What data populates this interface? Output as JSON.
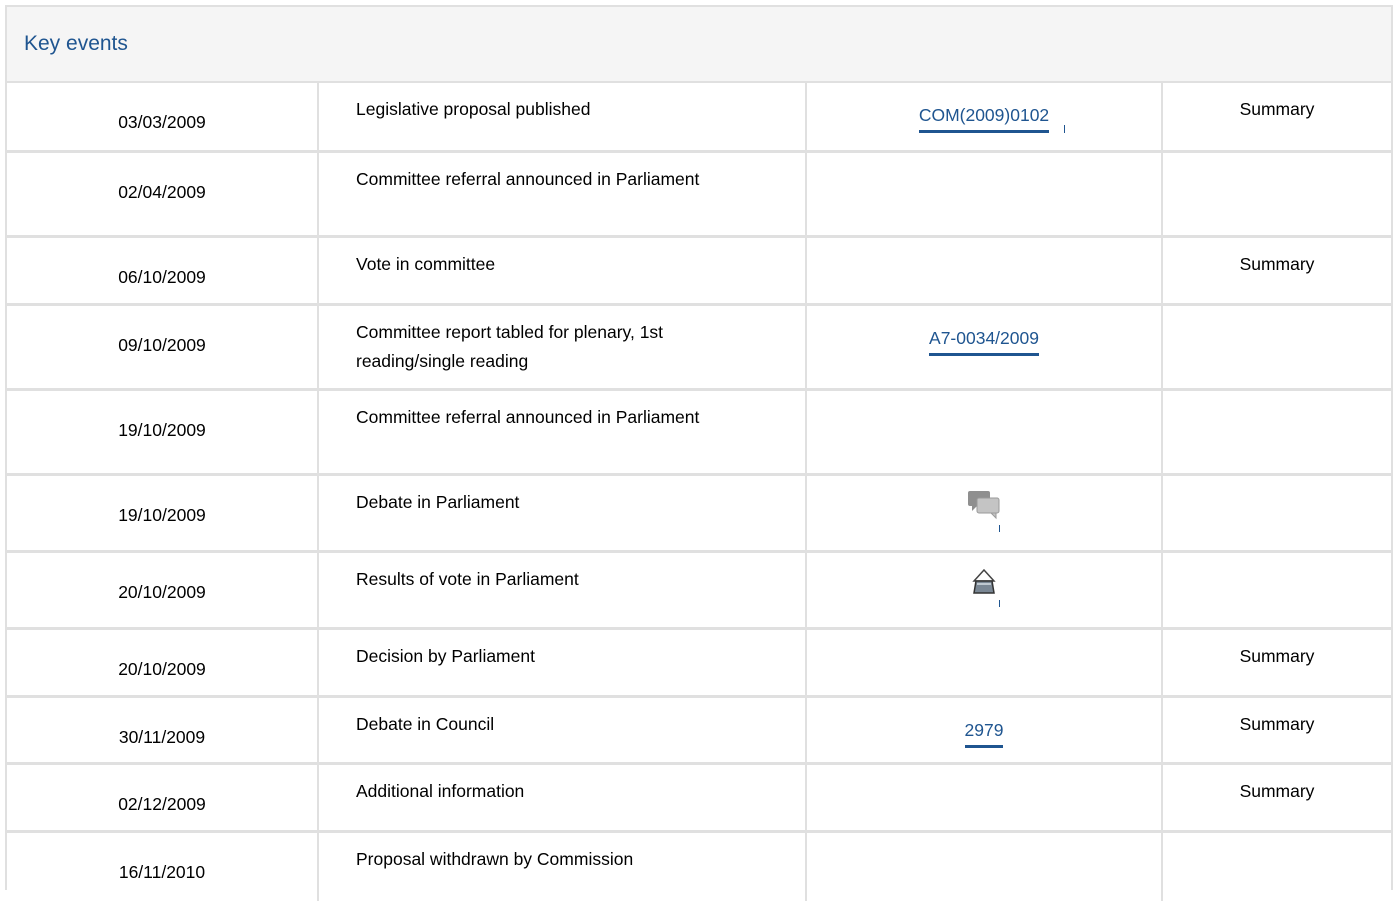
{
  "panel": {
    "title": "Key events"
  },
  "rows": [
    {
      "date": "03/03/2009",
      "event": "Legislative proposal published",
      "ref": "COM(2009)0102",
      "summary": "Summary"
    },
    {
      "date": "02/04/2009",
      "event": "Committee referral announced in Parliament",
      "ref": "",
      "summary": ""
    },
    {
      "date": "06/10/2009",
      "event": "Vote in committee",
      "ref": "",
      "summary": "Summary"
    },
    {
      "date": "09/10/2009",
      "event": "Committee report tabled for plenary, 1st reading/single reading",
      "ref": "A7-0034/2009",
      "summary": ""
    },
    {
      "date": "19/10/2009",
      "event": "Committee referral announced in Parliament",
      "ref": "",
      "summary": ""
    },
    {
      "date": "19/10/2009",
      "event": "Debate in Parliament",
      "ref_icon": "debate-icon",
      "summary": ""
    },
    {
      "date": "20/10/2009",
      "event": "Results of vote in Parliament",
      "ref_icon": "ballot-box-icon",
      "summary": ""
    },
    {
      "date": "20/10/2009",
      "event": "Decision by Parliament",
      "ref": "",
      "summary": "Summary"
    },
    {
      "date": "30/11/2009",
      "event": "Debate in Council",
      "ref": "2979",
      "summary": "Summary"
    },
    {
      "date": "02/12/2009",
      "event": "Additional information",
      "ref": "",
      "summary": "Summary"
    },
    {
      "date": "16/11/2010",
      "event": "Proposal withdrawn by Commission",
      "ref": "",
      "summary": ""
    }
  ],
  "colors": {
    "link": "#1f5590",
    "border": "#e0e0e0",
    "header_bg": "#f5f5f5"
  }
}
